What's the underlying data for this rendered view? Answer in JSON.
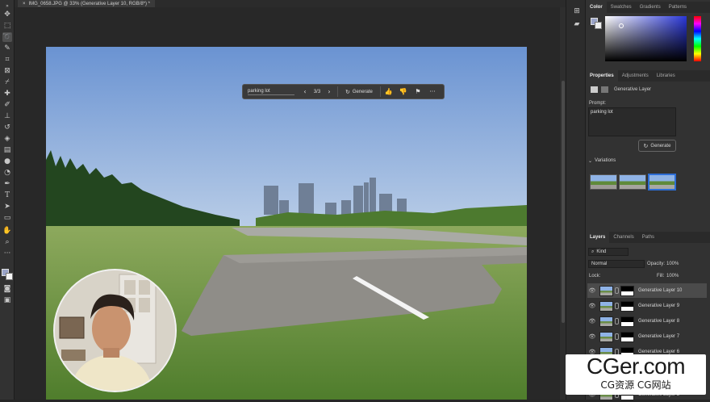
{
  "document_tab": {
    "title": "IMG_0658.JPG @ 33% (Generative Layer 10, RGB/8*) *",
    "close_glyph": "×"
  },
  "toolbar": {
    "tools": [
      "move",
      "artboard",
      "marquee",
      "lasso",
      "quick-select",
      "crop",
      "frame",
      "eyedropper",
      "healing",
      "brush",
      "clone-stamp",
      "history-brush",
      "eraser",
      "gradient",
      "blur",
      "dodge",
      "pen",
      "type",
      "path-select",
      "rectangle",
      "hand",
      "zoom",
      "more"
    ]
  },
  "taskbar": {
    "prompt": "parking lot",
    "counter": "3/3",
    "generate_label": "Generate",
    "more_glyph": "···"
  },
  "color_panel": {
    "tabs": [
      "Color",
      "Swatches",
      "Gradients",
      "Patterns"
    ],
    "active": "Color"
  },
  "properties_panel": {
    "tabs": [
      "Properties",
      "Adjustments",
      "Libraries"
    ],
    "active": "Properties",
    "layer_type": "Generative Layer",
    "prompt_label": "Prompt:",
    "prompt_value": "parking lot",
    "generate_label": "Generate",
    "variations_label": "Variations"
  },
  "layers_panel": {
    "tabs": [
      "Layers",
      "Channels",
      "Paths"
    ],
    "active": "Layers",
    "filter_kind": "Kind",
    "blend_mode": "Normal",
    "opacity_label": "Opacity:",
    "opacity_value": "100%",
    "lock_label": "Lock:",
    "fill_label": "Fill:",
    "fill_value": "100%",
    "layers": [
      {
        "name": "Generative Layer 10",
        "selected": true
      },
      {
        "name": "Generative Layer 9",
        "selected": false
      },
      {
        "name": "Generative Layer 8",
        "selected": false
      },
      {
        "name": "Generative Layer 7",
        "selected": false
      },
      {
        "name": "Generative Layer 6",
        "selected": false
      },
      {
        "name": "Generative Layer 5",
        "selected": false
      }
    ]
  },
  "watermark": {
    "big": "CGer.com",
    "small": "CG资源 CG网站"
  },
  "colors": {
    "ui_dark": "#262626",
    "panel": "#323232",
    "sky": "#7fa2d6",
    "grass": "#5f8a3a",
    "accent_blue": "#2d6ed6"
  }
}
